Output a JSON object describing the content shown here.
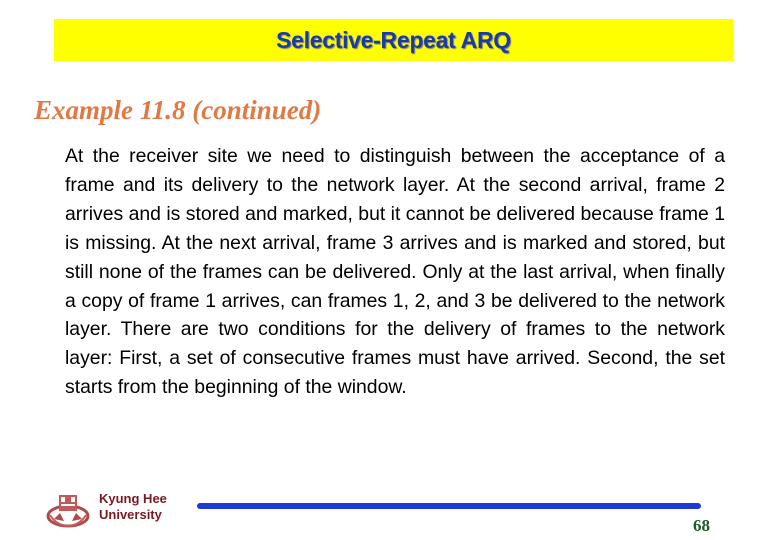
{
  "header": {
    "title": "Selective-Repeat ARQ"
  },
  "subtitle": "Example 11.8 (continued)",
  "body": {
    "paragraph": "At the receiver site we need to distinguish between the acceptance of a frame and its delivery to the network layer. At the second arrival, frame 2 arrives and is stored and marked, but it cannot be delivered because frame 1 is missing. At the next arrival, frame 3 arrives and is marked and stored, but still none of the frames can be delivered. Only at the last arrival, when finally a copy of frame 1 arrives, can frames 1, 2, and 3 be delivered to the network layer. There are two conditions for the delivery of frames to the network layer: First, a set of consecutive frames must have arrived. Second, the set starts from the beginning of the window."
  },
  "footer": {
    "logo_icon": "university-emblem-icon",
    "university_line1": "Kyung Hee",
    "university_line2": "University",
    "page_number": "68"
  },
  "colors": {
    "title_bar_bg": "#ffff00",
    "title_text": "#1a3aa8",
    "subtitle": "#e07a45",
    "university_text": "#7a1a22",
    "footer_line": "#1e3ad6",
    "page_number": "#1f5a2e"
  }
}
